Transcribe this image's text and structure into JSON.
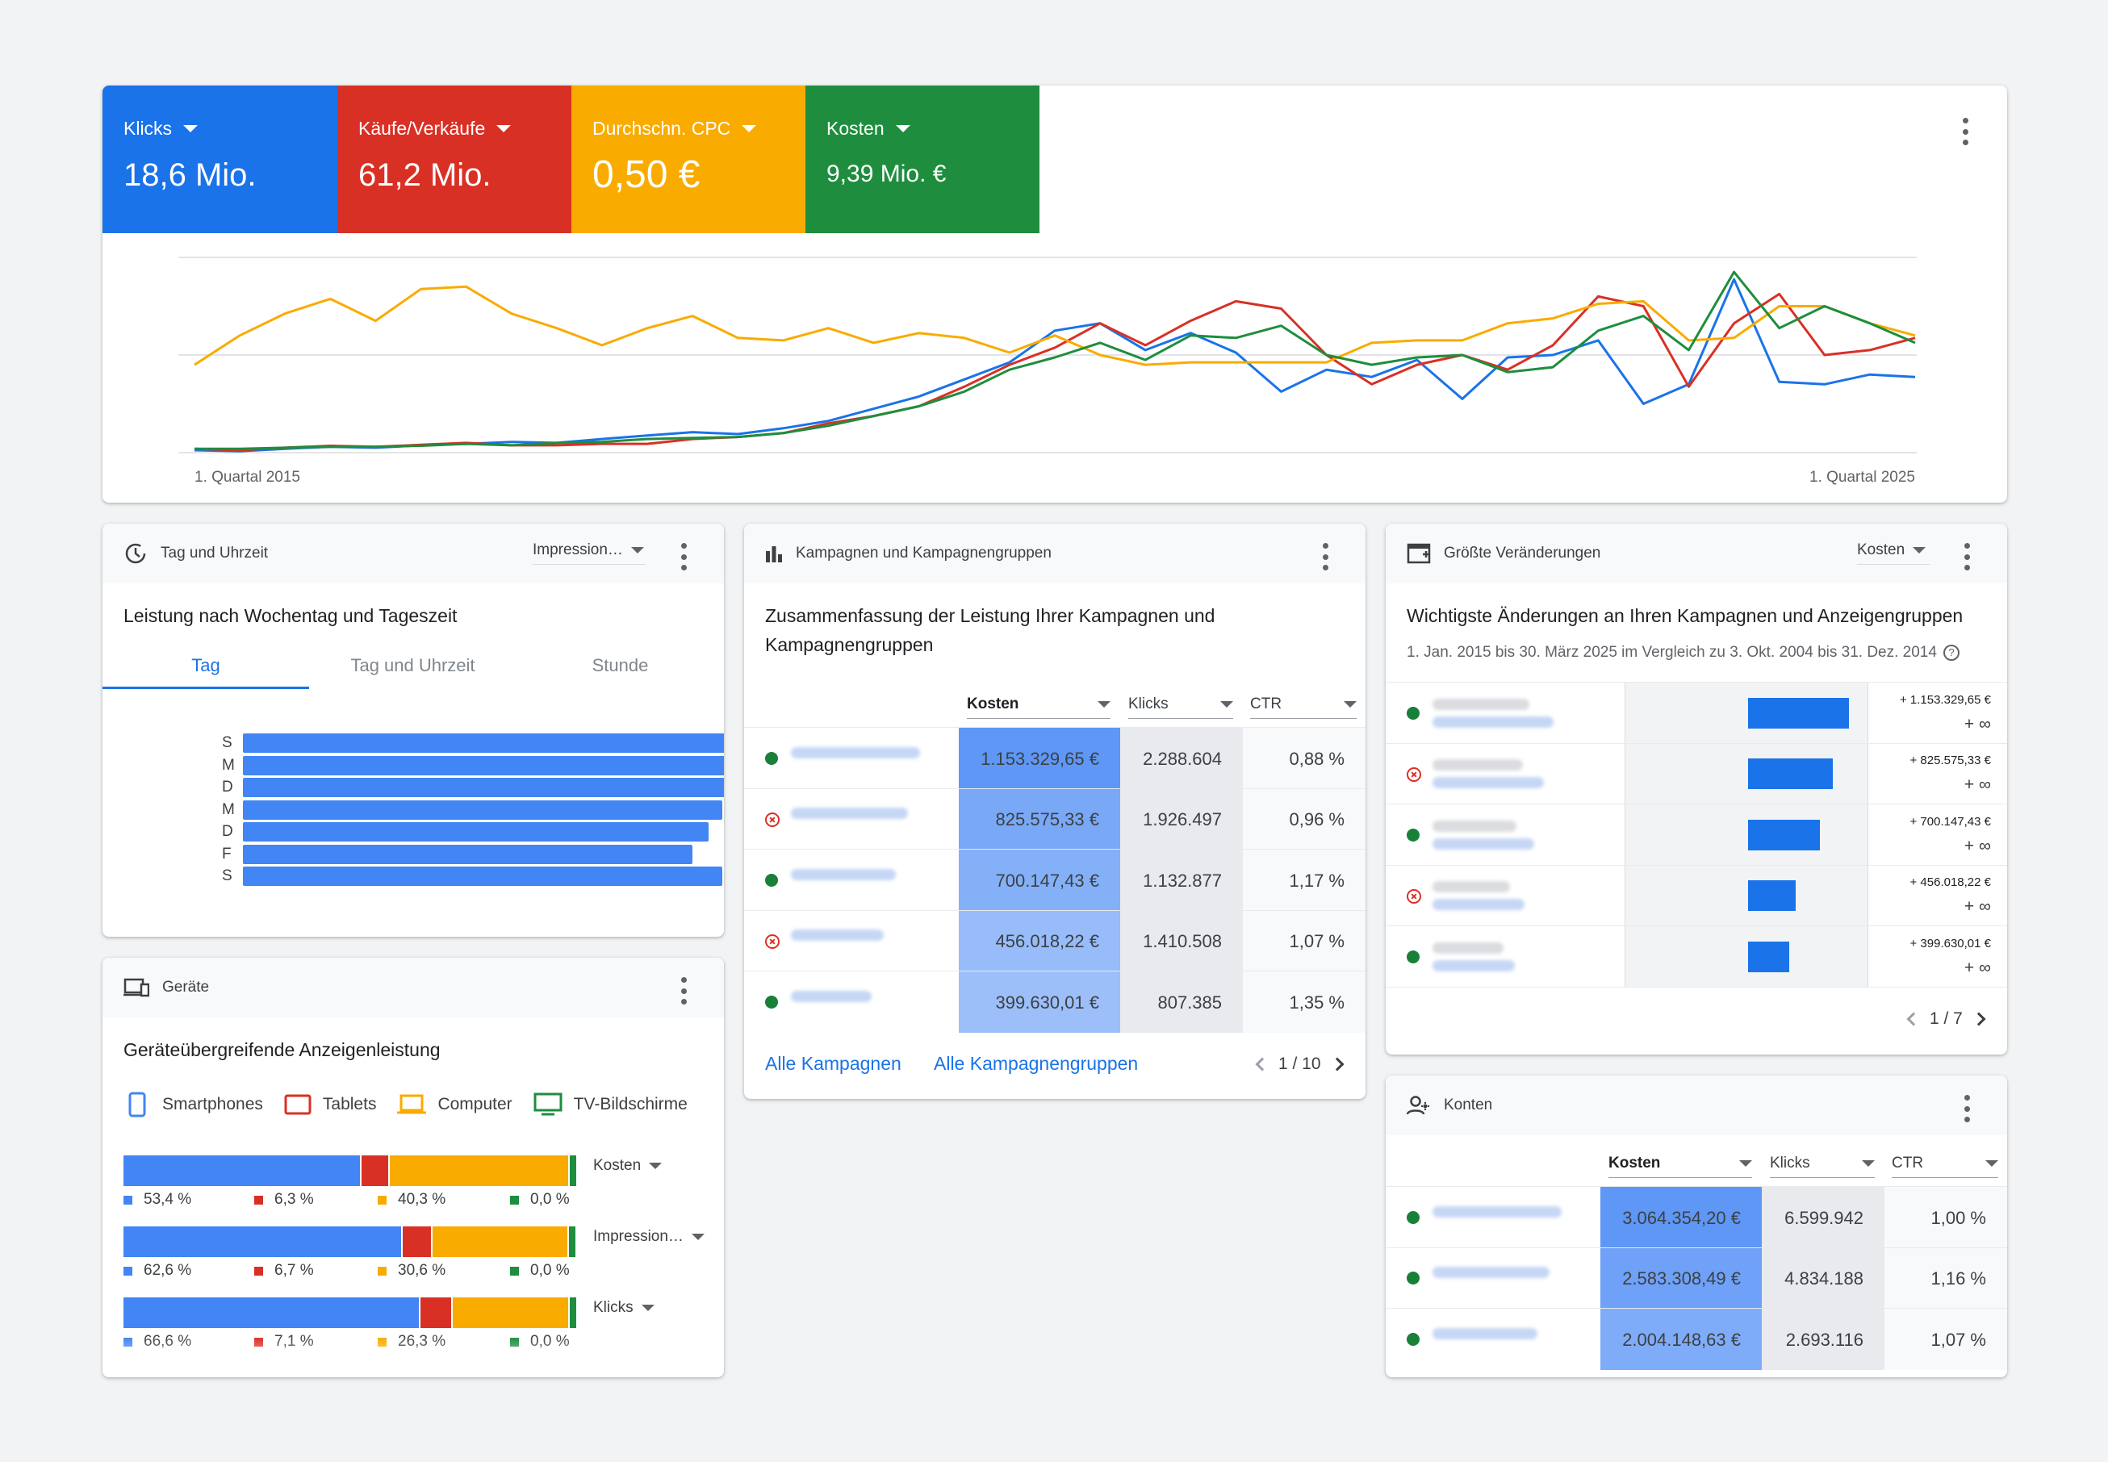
{
  "metrics": [
    {
      "label": "Klicks",
      "value": "18,6 Mio.",
      "color": "#1a73e8"
    },
    {
      "label": "Käufe/Verkäufe",
      "value": "61,2 Mio.",
      "color": "#d93025"
    },
    {
      "label": "Durchschn. CPC",
      "value": "0,50 €",
      "color": "#f9ab00"
    },
    {
      "label": "Kosten",
      "value": "9,39 Mio. €",
      "color": "#1e8e3e"
    }
  ],
  "chart_data": {
    "type": "line",
    "x_start_label": "1. Quartal 2015",
    "x_end_label": "1. Quartal 2025",
    "grid": true,
    "series": [
      {
        "name": "Klicks",
        "color": "#1a73e8",
        "values": [
          0.5,
          0.3,
          0.8,
          1.2,
          1.0,
          1.5,
          1.8,
          2.2,
          2.0,
          2.8,
          3.5,
          4.2,
          3.8,
          5.0,
          6.5,
          9.0,
          11.5,
          15.0,
          18.5,
          25.0,
          26.5,
          21.0,
          24.5,
          20.5,
          12.5,
          17.0,
          15.5,
          19.0,
          11.0,
          19.5,
          20.0,
          23.0,
          10.0,
          14.0,
          35.5,
          14.5,
          14.0,
          16.0,
          15.5
        ]
      },
      {
        "name": "Käufe/Verkäufe",
        "color": "#d93025",
        "values": [
          0.8,
          0.5,
          1.0,
          1.4,
          1.2,
          1.6,
          2.0,
          1.5,
          1.5,
          1.8,
          1.8,
          2.8,
          3.2,
          4.0,
          6.0,
          7.5,
          9.5,
          13.5,
          18.0,
          21.5,
          26.5,
          22.0,
          27.0,
          31.0,
          29.5,
          20.0,
          14.0,
          18.0,
          20.0,
          17.0,
          22.0,
          32.0,
          30.0,
          13.5,
          26.5,
          32.5,
          20.0,
          21.0,
          23.5
        ]
      },
      {
        "name": "Durchschn. CPC",
        "color": "#f9ab00",
        "values": [
          18.0,
          24.0,
          28.5,
          31.5,
          27.0,
          33.5,
          34.0,
          28.5,
          25.5,
          22.0,
          25.5,
          28.0,
          23.5,
          23.0,
          25.5,
          22.5,
          24.5,
          23.5,
          20.5,
          24.0,
          20.0,
          18.0,
          18.5,
          18.5,
          18.5,
          18.5,
          22.5,
          23.0,
          23.0,
          26.5,
          27.5,
          30.5,
          31.0,
          23.0,
          23.5,
          30.0,
          30.0,
          26.5,
          24.0
        ]
      },
      {
        "name": "Kosten",
        "color": "#1e8e3e",
        "values": [
          0.8,
          0.8,
          1.0,
          1.2,
          1.2,
          1.4,
          1.8,
          1.5,
          2.0,
          2.2,
          2.8,
          3.0,
          3.2,
          4.0,
          5.5,
          7.5,
          9.5,
          12.5,
          17.0,
          19.5,
          22.5,
          19.0,
          24.0,
          23.5,
          26.0,
          20.0,
          18.0,
          19.5,
          20.0,
          16.5,
          17.5,
          25.0,
          28.0,
          21.0,
          37.0,
          25.5,
          30.0,
          26.5,
          22.5
        ]
      }
    ]
  },
  "tag": {
    "header": "Tag und Uhrzeit",
    "dropdown": "Impression…",
    "title": "Leistung nach Wochentag und Tageszeit",
    "tabs": [
      "Tag",
      "Tag und Uhrzeit",
      "Stunde"
    ],
    "days": [
      "S",
      "M",
      "D",
      "M",
      "D",
      "F",
      "S"
    ],
    "bar_values": [
      100,
      88.5,
      87.5,
      87,
      84.5,
      81.5,
      87
    ]
  },
  "geraete": {
    "header": "Geräte",
    "title": "Geräteübergreifende Anzeigenleistung",
    "legend": [
      "Smartphones",
      "Tablets",
      "Computer",
      "TV-Bildschirme"
    ],
    "colors": [
      "#4285f4",
      "#d93025",
      "#f9ab00",
      "#1e8e3e"
    ],
    "rows": [
      {
        "metric": "Kosten",
        "values": [
          53.4,
          6.3,
          40.3,
          0.0
        ],
        "labels": [
          "53,4 %",
          "6,3 %",
          "40,3 %",
          "0,0 %"
        ]
      },
      {
        "metric": "Impression…",
        "values": [
          62.6,
          6.7,
          30.6,
          0.0
        ],
        "labels": [
          "62,6 %",
          "6,7 %",
          "30,6 %",
          "0,0 %"
        ]
      },
      {
        "metric": "Klicks",
        "values": [
          66.6,
          7.1,
          26.3,
          0.0
        ],
        "labels": [
          "66,6 %",
          "7,1 %",
          "26,3 %",
          "0,0 %"
        ]
      }
    ]
  },
  "kampagnen": {
    "header": "Kampagnen und Kampagnengruppen",
    "title": "Zusammenfassung der Leistung Ihrer Kampagnen und Kampagnengruppen",
    "columns": [
      "Kosten",
      "Klicks",
      "CTR"
    ],
    "rows": [
      {
        "status": "active",
        "kosten": "1.153.329,65 €",
        "klicks": "2.288.604",
        "ctr": "0,88 %"
      },
      {
        "status": "removed",
        "kosten": "825.575,33 €",
        "klicks": "1.926.497",
        "ctr": "0,96 %"
      },
      {
        "status": "active",
        "kosten": "700.147,43 €",
        "klicks": "1.132.877",
        "ctr": "1,17 %"
      },
      {
        "status": "removed",
        "kosten": "456.018,22 €",
        "klicks": "1.410.508",
        "ctr": "1,07 %"
      },
      {
        "status": "active",
        "kosten": "399.630,01 €",
        "klicks": "807.385",
        "ctr": "1,35 %"
      }
    ],
    "link_campaigns": "Alle Kampagnen",
    "link_groups": "Alle Kampagnengruppen",
    "pager": "1 / 10"
  },
  "changes": {
    "header": "Größte Veränderungen",
    "dropdown": "Kosten",
    "title": "Wichtigste Änderungen an Ihren Kampagnen und Anzeigengruppen",
    "subtitle": "1. Jan. 2015 bis 30. März 2025 im Vergleich zu 3. Okt. 2004 bis 31. Dez. 2014",
    "rows": [
      {
        "status": "active",
        "bar": 100,
        "value": "+ 1.153.329,65 €",
        "pct": "+ ∞"
      },
      {
        "status": "removed",
        "bar": 84,
        "value": "+ 825.575,33 €",
        "pct": "+ ∞"
      },
      {
        "status": "active",
        "bar": 71,
        "value": "+ 700.147,43 €",
        "pct": "+ ∞"
      },
      {
        "status": "removed",
        "bar": 47,
        "value": "+ 456.018,22 €",
        "pct": "+ ∞"
      },
      {
        "status": "active",
        "bar": 41,
        "value": "+ 399.630,01 €",
        "pct": "+ ∞"
      }
    ],
    "pager": "1 / 7"
  },
  "konten": {
    "header": "Konten",
    "columns": [
      "Kosten",
      "Klicks",
      "CTR"
    ],
    "rows": [
      {
        "status": "active",
        "kosten": "3.064.354,20 €",
        "klicks": "6.599.942",
        "ctr": "1,00 %"
      },
      {
        "status": "active",
        "kosten": "2.583.308,49 €",
        "klicks": "4.834.188",
        "ctr": "1,16 %"
      },
      {
        "status": "active",
        "kosten": "2.004.148,63 €",
        "klicks": "2.693.116",
        "ctr": "1,07 %"
      }
    ]
  }
}
